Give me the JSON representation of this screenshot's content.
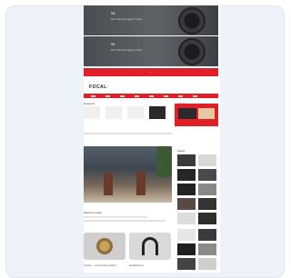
{
  "banners": [
    {
      "title": "S8",
      "text": "SC Thermal edge & more"
    },
    {
      "title": "S8",
      "text": "SC Thermal edge & more"
    }
  ],
  "promo_bar": "—",
  "logo": {
    "prefix": "FOCAL",
    "accent": "·"
  },
  "colors": {
    "accent": "#e01f26",
    "frame": "#eef3fa"
  },
  "sections": {
    "left": "Featured",
    "right": "Latest"
  },
  "hero": {
    "caption": "Sound in wood"
  },
  "sidebar": {
    "title": "Latest"
  },
  "products": [
    {
      "caption": "Utopia — anniversary edition"
    },
    {
      "caption": "Headphones"
    }
  ]
}
